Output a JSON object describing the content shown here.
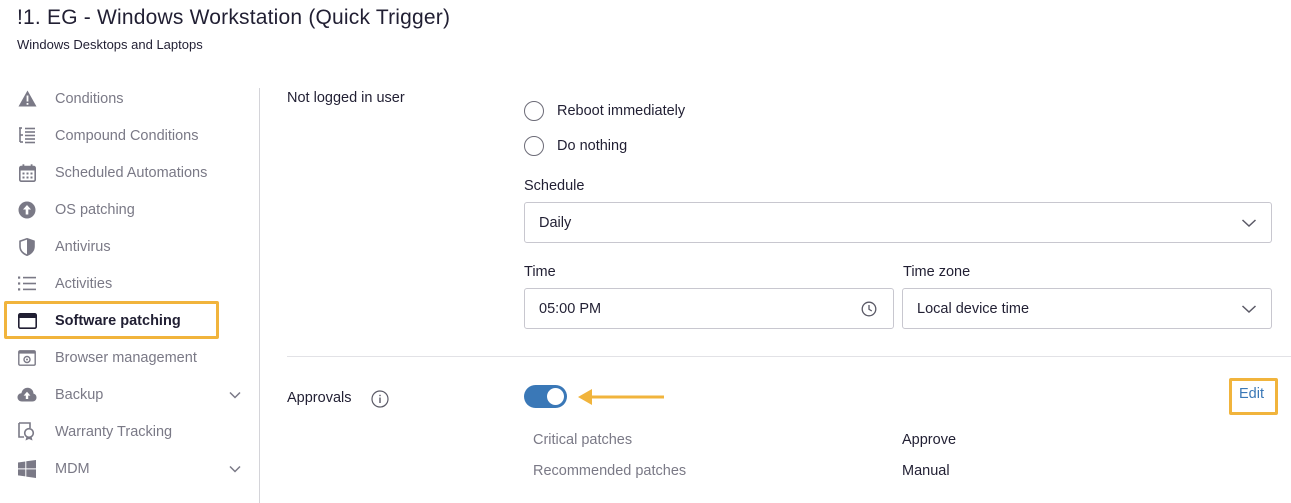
{
  "header": {
    "title": "!1. EG - Windows Workstation (Quick Trigger)",
    "subtitle": "Windows Desktops and Laptops"
  },
  "sidebar": {
    "items": [
      {
        "label": "Conditions",
        "icon": "warning-icon"
      },
      {
        "label": "Compound Conditions",
        "icon": "tree-list-icon"
      },
      {
        "label": "Scheduled Automations",
        "icon": "calendar-icon"
      },
      {
        "label": "OS patching",
        "icon": "upload-circle-icon"
      },
      {
        "label": "Antivirus",
        "icon": "shield-icon"
      },
      {
        "label": "Activities",
        "icon": "list-icon"
      },
      {
        "label": "Software patching",
        "icon": "window-icon",
        "active": true
      },
      {
        "label": "Browser management",
        "icon": "browser-icon"
      },
      {
        "label": "Backup",
        "icon": "cloud-upload-icon",
        "expandable": true
      },
      {
        "label": "Warranty Tracking",
        "icon": "warranty-icon"
      },
      {
        "label": "MDM",
        "icon": "windows-logo-icon",
        "expandable": true
      }
    ]
  },
  "main": {
    "not_logged_in": {
      "label": "Not logged in user",
      "options": [
        "Reboot immediately",
        "Do nothing"
      ]
    },
    "schedule": {
      "label": "Schedule",
      "value": "Daily"
    },
    "time": {
      "label": "Time",
      "value": "05:00 PM"
    },
    "timezone": {
      "label": "Time zone",
      "value": "Local device time"
    },
    "approvals": {
      "label": "Approvals",
      "enabled": true,
      "edit_label": "Edit",
      "rows": [
        {
          "key": "Critical patches",
          "value": "Approve"
        },
        {
          "key": "Recommended patches",
          "value": "Manual"
        }
      ]
    }
  },
  "colors": {
    "accent": "#3a78b7",
    "highlight": "#f1b43c",
    "muted_text": "#7a7986",
    "text": "#211f33"
  }
}
